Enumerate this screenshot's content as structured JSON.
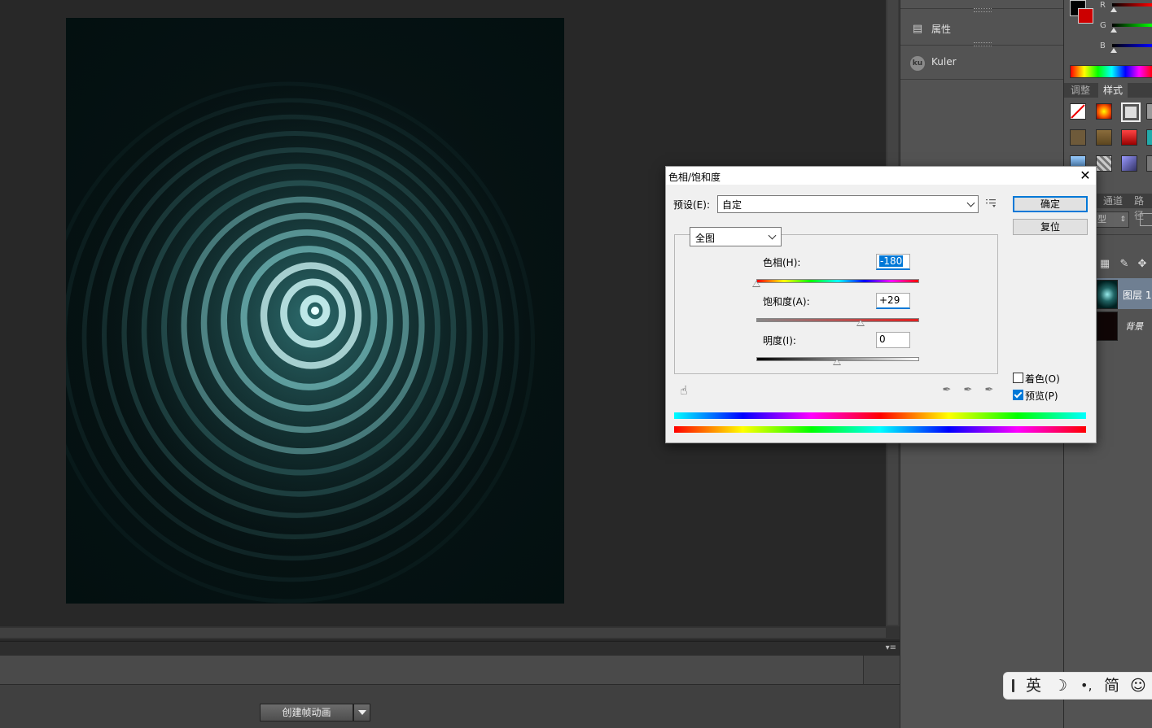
{
  "panels": {
    "properties_label": "属性",
    "kuler_label": "Kuler",
    "kuler_icon_text": "ku"
  },
  "color_panel": {
    "channels": [
      "R",
      "G",
      "B"
    ],
    "foreground": "#000000",
    "background": "#cc0000"
  },
  "styles_panel": {
    "tabs": [
      "调整",
      "样式"
    ],
    "active_tab": "样式"
  },
  "layers_panel": {
    "tabs": [
      "通道",
      "路径"
    ],
    "kind_filter": "型",
    "layers": [
      {
        "name": "图层 1",
        "selected": true
      },
      {
        "name": "背景",
        "selected": false
      }
    ]
  },
  "timeline": {
    "create_button": "创建帧动画"
  },
  "ime": {
    "items": [
      "英",
      "☽",
      "•,",
      "简",
      "☺"
    ]
  },
  "dialog": {
    "title": "色相/饱和度",
    "close_glyph": "✕",
    "preset_label": "预设(E):",
    "preset_value": "自定",
    "ok_label": "确定",
    "reset_label": "复位",
    "edit_value": "全图",
    "hue_label": "色相(H):",
    "hue_value": "-180",
    "saturation_label": "饱和度(A):",
    "saturation_value": "+29",
    "lightness_label": "明度(I):",
    "lightness_value": "0",
    "colorize_label": "着色(O)",
    "colorize_checked": false,
    "preview_label": "预览(P)",
    "preview_checked": true,
    "accent_color": "#0078d7"
  }
}
